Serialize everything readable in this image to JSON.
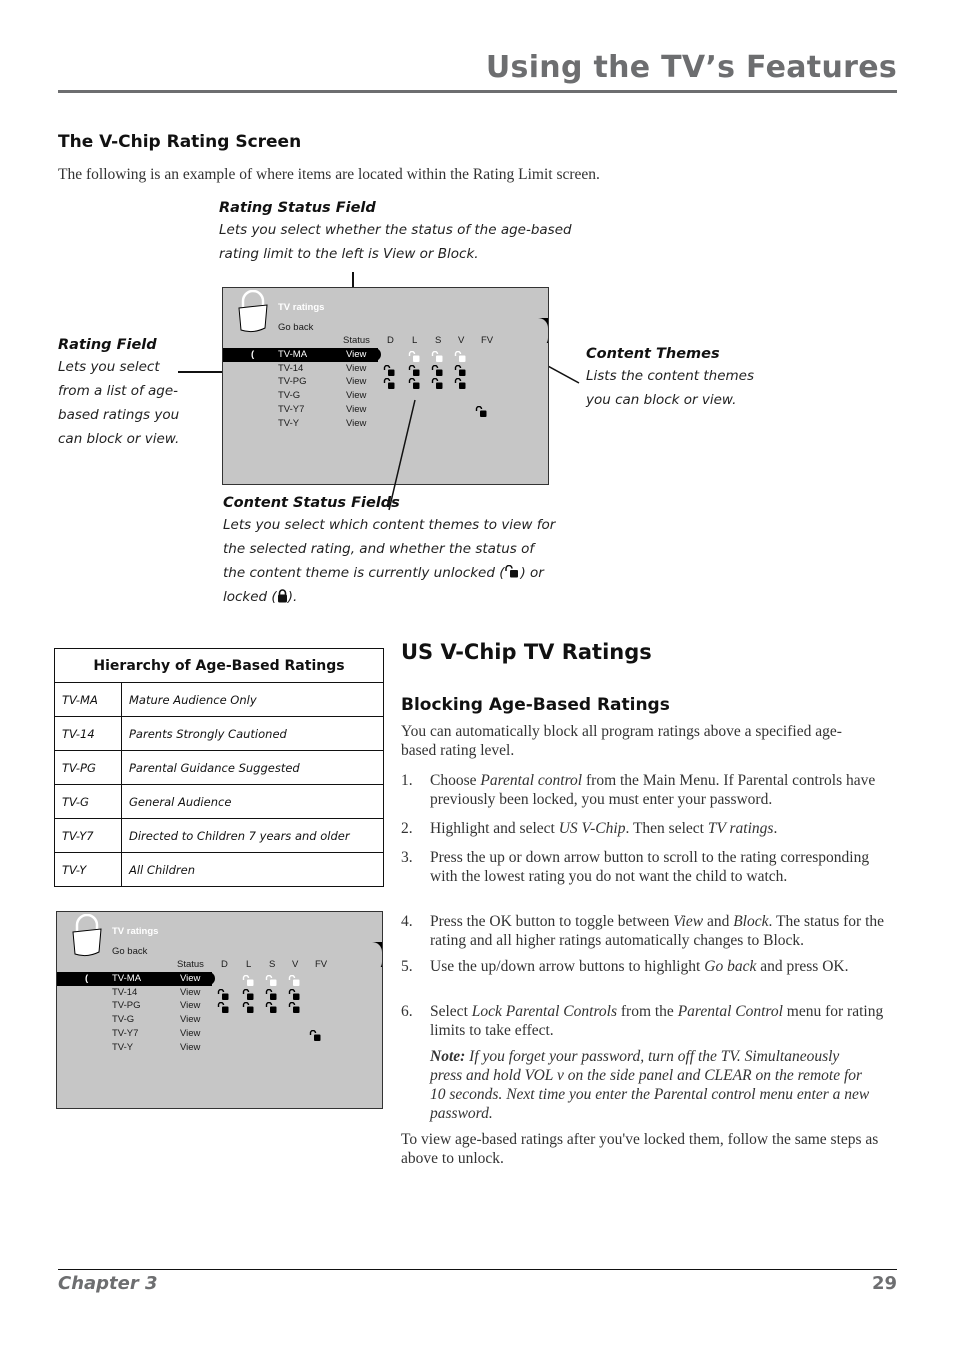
{
  "header": {
    "title": "Using the TV’s Features"
  },
  "section": {
    "heading": "The V-Chip Rating Screen",
    "intro": "The following is an example of where items are located within the Rating Limit screen."
  },
  "callouts": {
    "rating_status": {
      "title": "Rating Status Field",
      "lines": [
        "Lets you select whether the status of the age-based",
        "rating limit to the left is View or Block."
      ]
    },
    "rating_field": {
      "title": "Rating Field",
      "lines": [
        "Lets you select",
        "from a list of age-",
        "based ratings you",
        "can block or view."
      ]
    },
    "content_themes": {
      "title": "Content Themes",
      "lines": [
        "Lists the content themes",
        "you can block or view."
      ]
    },
    "content_status": {
      "title": "Content Status Fields",
      "lines": [
        "Lets you select which content themes to view for",
        "the selected rating, and whether the status of"
      ],
      "line3_before": "the content theme is currently unlocked (",
      "line3_after": ") or",
      "line4_before": "locked (",
      "line4_after": ")."
    }
  },
  "tv_screen": {
    "title": "TV ratings",
    "go_back": "Go back",
    "status_header": "Status",
    "themes": [
      "D",
      "L",
      "S",
      "V",
      "FV"
    ],
    "cursor": "(",
    "rows": [
      {
        "rating": "TV-MA",
        "status": "View",
        "selected": true,
        "locks": [
          "",
          "unlocked",
          "unlocked",
          "unlocked",
          ""
        ]
      },
      {
        "rating": "TV-14",
        "status": "View",
        "selected": false,
        "locks": [
          "unlocked",
          "unlocked",
          "unlocked",
          "unlocked",
          ""
        ]
      },
      {
        "rating": "TV-PG",
        "status": "View",
        "selected": false,
        "locks": [
          "unlocked",
          "unlocked",
          "unlocked",
          "unlocked",
          ""
        ]
      },
      {
        "rating": "TV-G",
        "status": "View",
        "selected": false,
        "locks": [
          "",
          "",
          "",
          "",
          ""
        ]
      },
      {
        "rating": "TV-Y7",
        "status": "View",
        "selected": false,
        "locks": [
          "",
          "",
          "",
          "",
          "unlocked"
        ]
      },
      {
        "rating": "TV-Y",
        "status": "View",
        "selected": false,
        "locks": [
          "",
          "",
          "",
          "",
          ""
        ]
      }
    ]
  },
  "hierarchy_table": {
    "title": "Hierarchy of Age-Based Ratings",
    "rows": [
      {
        "code": "TV-MA",
        "desc": "Mature Audience Only"
      },
      {
        "code": "TV-14",
        "desc": "Parents Strongly Cautioned"
      },
      {
        "code": "TV-PG",
        "desc": "Parental Guidance Suggested"
      },
      {
        "code": "TV-G",
        "desc": "General Audience"
      },
      {
        "code": "TV-Y7",
        "desc": "Directed to Children 7 years and older"
      },
      {
        "code": "TV-Y",
        "desc": "All Children"
      }
    ]
  },
  "vchip": {
    "heading": "US V-Chip TV Ratings",
    "subheading": "Blocking Age-Based Ratings",
    "intro_l1": "You can automatically block all program ratings above a specified age-",
    "intro_l2": "based rating level.",
    "steps": [
      {
        "num": "1.",
        "parts": [
          [
            "Choose ",
            false
          ],
          [
            "Parental control",
            true
          ],
          [
            " from the Main Menu. If Parental controls have previously been locked, you must enter your password.",
            false
          ]
        ]
      },
      {
        "num": "2.",
        "parts": [
          [
            "Highlight and select ",
            false
          ],
          [
            "US V-Chip",
            true
          ],
          [
            ". Then select ",
            false
          ],
          [
            "TV ratings",
            true
          ],
          [
            ".",
            false
          ]
        ]
      },
      {
        "num": "3.",
        "parts": [
          [
            "Press the up or down arrow button to scroll to the rating corresponding with the lowest rating you do not want the child to watch.",
            false
          ]
        ]
      },
      {
        "num": "4.",
        "parts": [
          [
            "Press the OK button to toggle between ",
            false
          ],
          [
            "View",
            true
          ],
          [
            " and ",
            false
          ],
          [
            "Block",
            true
          ],
          [
            ". The status for the rating and all higher ratings automatically changes to Block.",
            false
          ]
        ]
      },
      {
        "num": "5.",
        "parts": [
          [
            "Use the up/down arrow buttons to highlight ",
            false
          ],
          [
            "Go back",
            true
          ],
          [
            " and press OK.",
            false
          ]
        ]
      },
      {
        "num": "6.",
        "parts": [
          [
            "Select ",
            false
          ],
          [
            "Lock Parental Controls",
            true
          ],
          [
            " from the ",
            false
          ],
          [
            "Parental Control",
            true
          ],
          [
            " menu for rating limits to take effect.",
            false
          ]
        ]
      }
    ],
    "note_label": "Note:",
    "note_text": " If you forget your password, turn off the TV. Simultaneously press and hold VOL v on the side panel and CLEAR on the remote for 10 seconds. Next time you enter the Parental control menu enter a new password.",
    "closing": "To view age-based ratings after you've locked them, follow the same steps as above to unlock."
  },
  "footer": {
    "chapter": "Chapter 3",
    "page": "29"
  }
}
